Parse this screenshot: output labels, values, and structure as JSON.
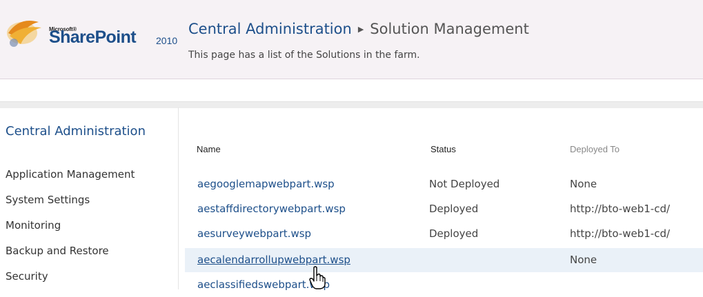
{
  "header": {
    "brand_small": "Microsoft®",
    "brand": "SharePoint",
    "version": "2010",
    "breadcrumb": [
      "Central Administration",
      "Solution Management"
    ],
    "subtitle": "This page has a list of the Solutions in the farm."
  },
  "nav": {
    "heading": "Central Administration",
    "items": [
      "Application Management",
      "System Settings",
      "Monitoring",
      "Backup and Restore",
      "Security"
    ]
  },
  "table": {
    "columns": [
      "Name",
      "Status",
      "Deployed To"
    ],
    "rows": [
      {
        "name": "aegooglemapwebpart.wsp",
        "status": "Not Deployed",
        "deployed_to": "None"
      },
      {
        "name": "aestaffdirectorywebpart.wsp",
        "status": "Deployed",
        "deployed_to": "http://bto-web1-cd/"
      },
      {
        "name": "aesurveywebpart.wsp",
        "status": "Deployed",
        "deployed_to": "http://bto-web1-cd/"
      },
      {
        "name": "aecalendarrollupwebpart.wsp",
        "status": "",
        "deployed_to": "None"
      },
      {
        "name": "aeclassifiedswebpart.wsp",
        "status": "",
        "deployed_to": ""
      }
    ]
  },
  "icons": {
    "logo": "sharepoint-logo-icon",
    "cursor": "hand-cursor-icon"
  }
}
